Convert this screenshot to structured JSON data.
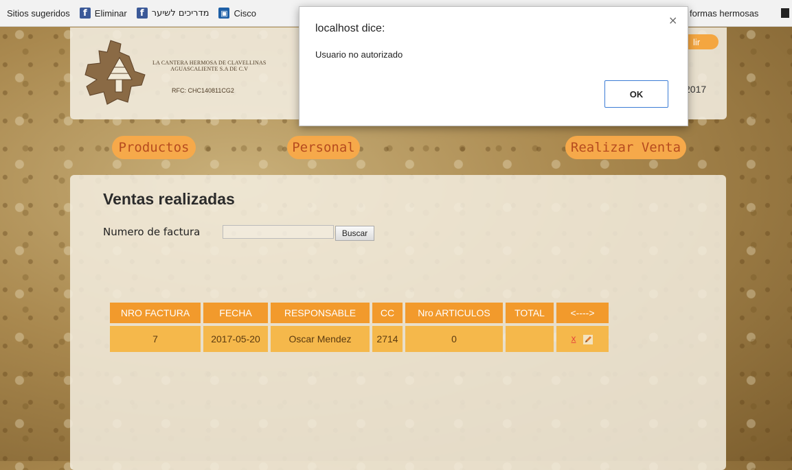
{
  "bookmarks": {
    "items": [
      {
        "label": "Sitios sugeridos",
        "icon": "none"
      },
      {
        "label": "Eliminar",
        "icon": "facebook-icon"
      },
      {
        "label": "מדריכים לשיער",
        "icon": "facebook-icon"
      },
      {
        "label": "Cisco",
        "icon": "cisco-icon"
      }
    ],
    "right_label": "formas hermosas"
  },
  "header": {
    "company_line1": "LA CANTERA HERMOSA DE CLAVELLINAS",
    "company_line2": "AGUASCALIENTE S.A DE C.V",
    "rfc": "RFC: CHC140811CG2",
    "salir_partial": "lir",
    "date_partial": "2017"
  },
  "nav": {
    "productos": "Productos",
    "personal": "Personal",
    "realizar_venta": "Realizar Venta"
  },
  "main": {
    "title": "Ventas realizadas",
    "search_label": "Numero de factura",
    "search_value": "",
    "search_button": "Buscar",
    "table": {
      "headers": [
        "NRO FACTURA",
        "FECHA",
        "RESPONSABLE",
        "CC",
        "Nro ARTICULOS",
        "TOTAL",
        "<---->"
      ],
      "rows": [
        {
          "nro_factura": "7",
          "fecha": "2017-05-20",
          "responsable": "Oscar Mendez",
          "cc": "2714",
          "nro_articulos": "0",
          "total": "",
          "delete_label": "x"
        }
      ]
    }
  },
  "alert": {
    "title": "localhost dice:",
    "message": "Usuario no autorizado",
    "ok_label": "OK",
    "close_glyph": "×"
  },
  "colors": {
    "orange_header": "#f29a2c",
    "orange_cell": "#f5b84b",
    "nav_pill": "#f6a94a",
    "nav_text": "#b64b1f",
    "delete_red": "#e64a3c",
    "ok_border": "#3a7bd5"
  }
}
